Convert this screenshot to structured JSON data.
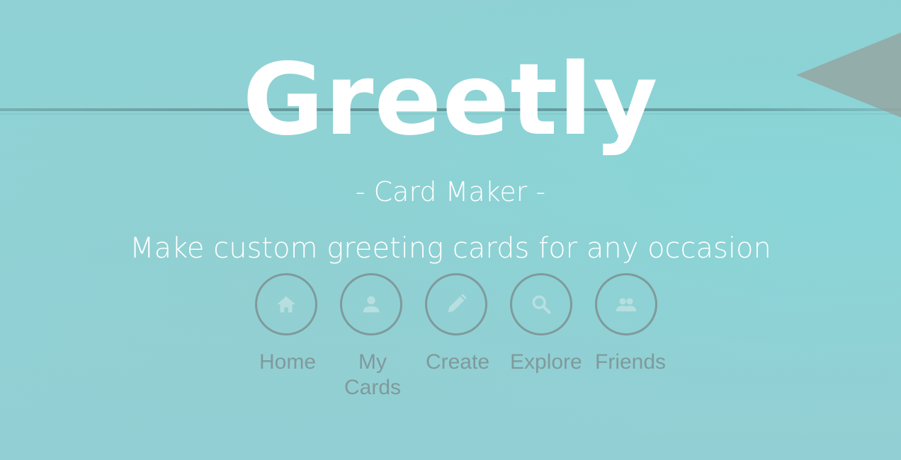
{
  "app": {
    "title": "Greetly",
    "subtitle": "- Card Maker -",
    "tagline": "Make custom greeting cards for any occasion"
  },
  "nav": {
    "items": [
      {
        "label": "Home",
        "icon": "home-icon"
      },
      {
        "label": "My Cards",
        "icon": "person-icon"
      },
      {
        "label": "Create",
        "icon": "pencil-icon"
      },
      {
        "label": "Explore",
        "icon": "search-icon"
      },
      {
        "label": "Friends",
        "icon": "people-icon"
      }
    ]
  },
  "colors": {
    "background": "#8fd1d4",
    "title": "#ffffff",
    "nav": "#7f9a9c",
    "icon_fill": "#b8dfe0"
  }
}
